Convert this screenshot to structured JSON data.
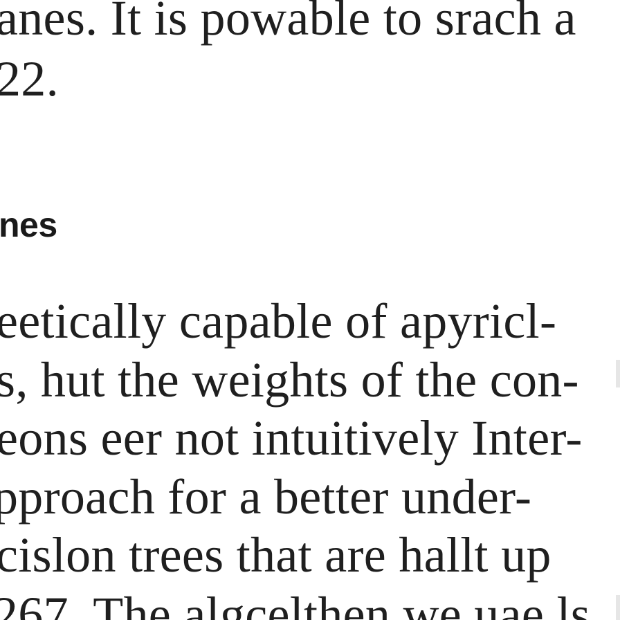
{
  "document": {
    "top_paragraph": [
      "anes.  It is powable to srach a",
      "22."
    ],
    "section_heading": "nes",
    "body_paragraph": [
      "eetically capable of apyricl-",
      "s, hut the weights of the con-",
      "eons eer not intuitively Inter-",
      "pproach for a better under-",
      "cislon trees that are hallt up",
      "267.  The algcelthen we uae ls"
    ]
  }
}
